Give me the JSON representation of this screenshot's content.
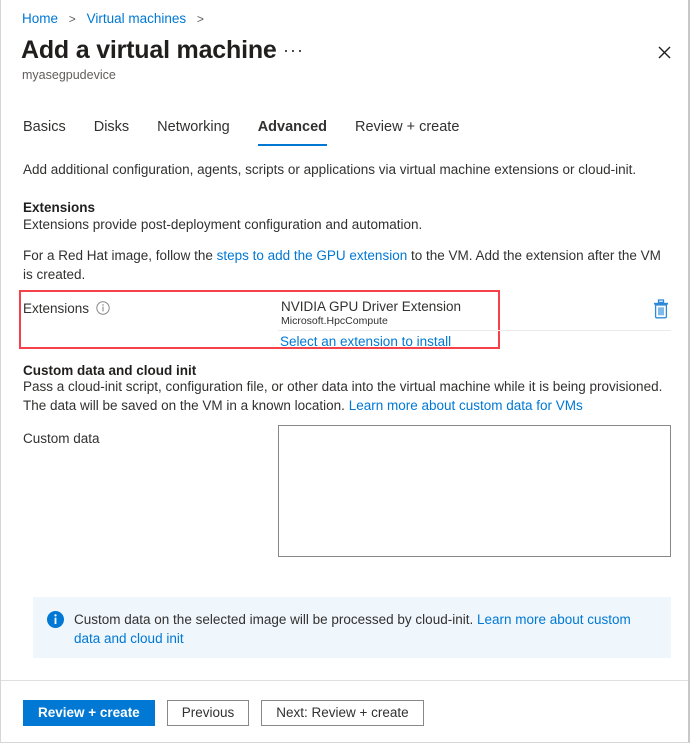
{
  "breadcrumb": {
    "items": [
      "Home",
      "Virtual machines"
    ],
    "separator": ">"
  },
  "header": {
    "title": "Add a virtual machine",
    "ellipsis": "···",
    "subtitle": "myasegpudevice",
    "close_icon": "close-icon"
  },
  "tabs": [
    {
      "label": "Basics",
      "active": false
    },
    {
      "label": "Disks",
      "active": false
    },
    {
      "label": "Networking",
      "active": false
    },
    {
      "label": "Advanced",
      "active": true
    },
    {
      "label": "Review + create",
      "active": false
    }
  ],
  "intro": "Add additional configuration, agents, scripts or applications via virtual machine extensions or cloud-init.",
  "extensions_section": {
    "heading": "Extensions",
    "description": "Extensions provide post-deployment configuration and automation.",
    "redhat_prefix": "For a Red Hat image, follow the ",
    "redhat_link": "steps to add the GPU extension",
    "redhat_suffix": " to the VM. Add the extension after the VM is created.",
    "row_label": "Extensions",
    "info_icon": "info-icon",
    "extension_name": "NVIDIA GPU Driver Extension",
    "extension_publisher": "Microsoft.HpcCompute",
    "select_link": "Select an extension to install",
    "delete_icon": "trash-icon",
    "highlight_color": "#f6404a"
  },
  "custom_data_section": {
    "heading": "Custom data and cloud init",
    "description_part1": "Pass a cloud-init script, configuration file, or other data into the virtual machine while it is being provisioned. The data will be saved on the VM in a known location. ",
    "description_link": "Learn more about custom data for VMs",
    "field_label": "Custom data",
    "textarea_value": "",
    "textarea_placeholder": ""
  },
  "info_banner": {
    "icon": "info-circle-icon",
    "text_part1": "Custom data on the selected image will be processed by cloud-init. ",
    "link": "Learn more about custom data and cloud init",
    "background": "#eff6fc"
  },
  "footer": {
    "primary_button": "Review + create",
    "previous_button": "Previous",
    "next_button": "Next: Review + create"
  },
  "colors": {
    "accent": "#0078d4",
    "link": "#0078d4",
    "highlight": "#f6404a"
  }
}
